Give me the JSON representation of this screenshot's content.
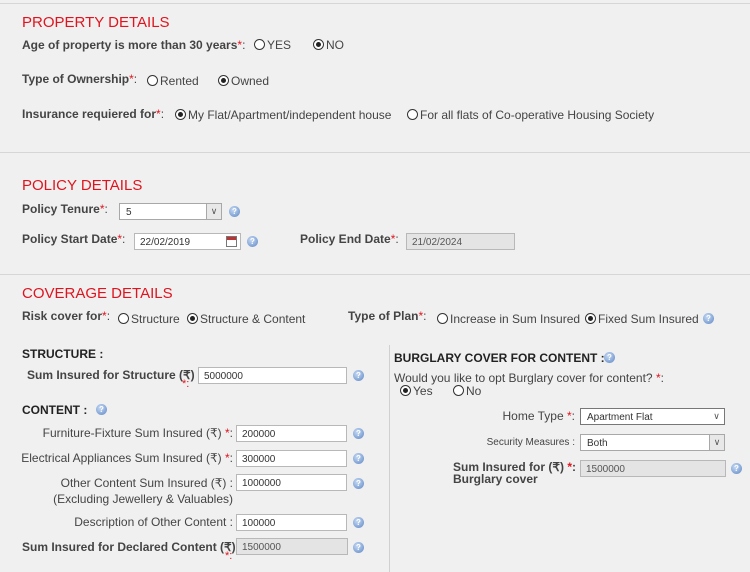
{
  "property": {
    "title": "PROPERTY DETAILS",
    "age_label": "Age of property is more than 30 years",
    "age_options": [
      "YES",
      "NO"
    ],
    "age_selected": "NO",
    "ownership_label": "Type of Ownership",
    "ownership_options": [
      "Rented",
      "Owned"
    ],
    "ownership_selected": "Owned",
    "insurance_label": "Insurance requiered for",
    "insurance_options": [
      "My Flat/Apartment/independent house",
      "For all flats of Co-operative Housing Society"
    ],
    "insurance_selected": "My Flat/Apartment/independent house"
  },
  "policy": {
    "title": "POLICY DETAILS",
    "tenure_label": "Policy Tenure",
    "tenure_value": "5",
    "start_label": "Policy Start Date",
    "start_value": "22/02/2019",
    "end_label": "Policy End Date",
    "end_value": "21/02/2024"
  },
  "coverage": {
    "title": "COVERAGE DETAILS",
    "risk_label": "Risk cover for",
    "risk_options": [
      "Structure",
      "Structure & Content"
    ],
    "risk_selected": "Structure & Content",
    "plan_label": "Type of Plan",
    "plan_options": [
      "Increase in Sum Insured",
      "Fixed Sum Insured"
    ],
    "plan_selected": "Fixed Sum Insured",
    "structure_heading": "STRUCTURE :",
    "structure_sum_label": "Sum Insured for Structure (₹)",
    "structure_sum_value": "5000000",
    "content_heading": "CONTENT :",
    "furniture_label": "Furniture-Fixture Sum Insured (₹)",
    "furniture_value": "200000",
    "electrical_label": "Electrical Appliances Sum Insured (₹)",
    "electrical_value": "300000",
    "other_label": "Other Content Sum Insured (₹) :",
    "other_sublabel": "(Excluding Jewellery & Valuables)",
    "other_value": "1000000",
    "description_label": "Description of Other Content :",
    "description_value": "100000",
    "declared_label": "Sum Insured for Declared Content (₹)",
    "declared_value": "1500000"
  },
  "burglary": {
    "heading": "BURGLARY COVER FOR CONTENT :",
    "question": "Would you like to opt Burglary cover for content?",
    "options": [
      "Yes",
      "No"
    ],
    "selected": "Yes",
    "home_type_label": "Home Type",
    "home_type_value": "Apartment Flat",
    "security_label": "Security Measures :",
    "security_value": "Both",
    "sum_label_1": "Sum Insured for (₹)",
    "sum_label_2": "Burglary cover",
    "sum_value": "1500000"
  },
  "required_mark": "*",
  "colors": {
    "section_title": "#e0141e",
    "background": "#f0f0f0"
  }
}
